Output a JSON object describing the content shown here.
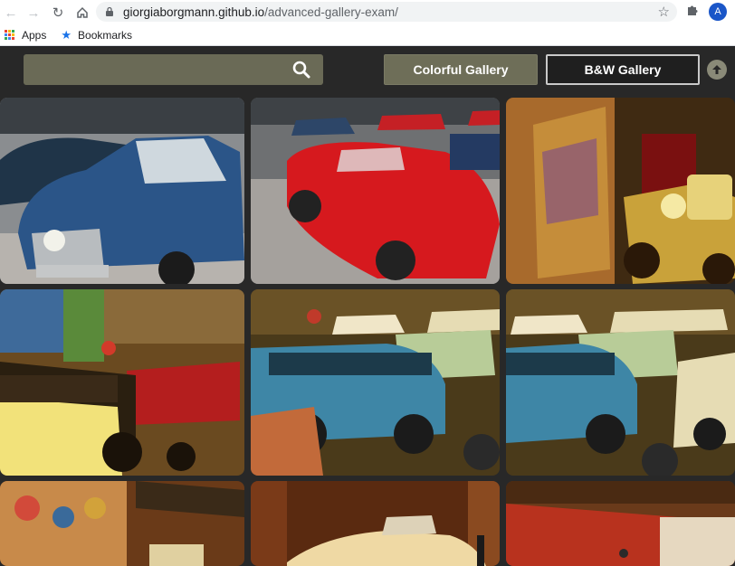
{
  "browser": {
    "url_host": "giorgiaborgmann.github.io",
    "url_path": "/advanced-gallery-exam/",
    "profile_initial": "A",
    "bookmarks": [
      {
        "label": "Apps"
      },
      {
        "label": "Bookmarks"
      }
    ]
  },
  "gallery": {
    "search_placeholder": "",
    "buttons": {
      "colorful": "Colorful Gallery",
      "bw": "B&W Gallery"
    },
    "photos": [
      {
        "subject": "blue-renault-car"
      },
      {
        "subject": "red-sports-car"
      },
      {
        "subject": "yellow-vintage-car"
      },
      {
        "subject": "vintage-bus-and-red-truck"
      },
      {
        "subject": "blue-van-and-cars"
      },
      {
        "subject": "blue-van-and-cars-duplicate"
      },
      {
        "subject": "mural-wall"
      },
      {
        "subject": "cream-sports-car"
      },
      {
        "subject": "garage-interior"
      }
    ]
  },
  "colors": {
    "page_bg": "#282828",
    "search_bg": "#6a6a56",
    "colorful_btn_bg": "#6e6e58",
    "bw_btn_border": "#c9c9c9",
    "profile": "#1a56c8"
  }
}
